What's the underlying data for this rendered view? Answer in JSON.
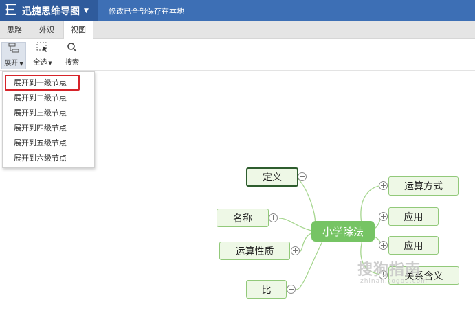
{
  "app": {
    "name": "迅捷思维导图",
    "save_status": "修改已全部保存在本地"
  },
  "tabs": [
    {
      "label": "思路",
      "active": false
    },
    {
      "label": "外观",
      "active": false
    },
    {
      "label": "视图",
      "active": true
    }
  ],
  "toolbar": {
    "expand_label": "展开",
    "select_all_label": "全选",
    "search_label": "搜索"
  },
  "expand_menu": {
    "items": [
      "展开到一级节点",
      "展开到二级节点",
      "展开到三级节点",
      "展开到四级节点",
      "展开到五级节点",
      "展开到六级节点"
    ],
    "highlighted_index": 0
  },
  "mindmap": {
    "central": "小学除法",
    "left": [
      "定义",
      "名称",
      "运算性质",
      "比"
    ],
    "right": [
      "运算方式",
      "应用",
      "应用",
      "关系含义"
    ],
    "selected": "定义",
    "branch_color": "#92c97a",
    "central_color": "#76c464"
  },
  "colors": {
    "titlebar": "#3d6fb5",
    "app_button": "#2f5b9c",
    "highlight_box": "#d6242a"
  },
  "watermark": {
    "text": "搜狗指南",
    "url": "zhinan.sogou.com"
  }
}
